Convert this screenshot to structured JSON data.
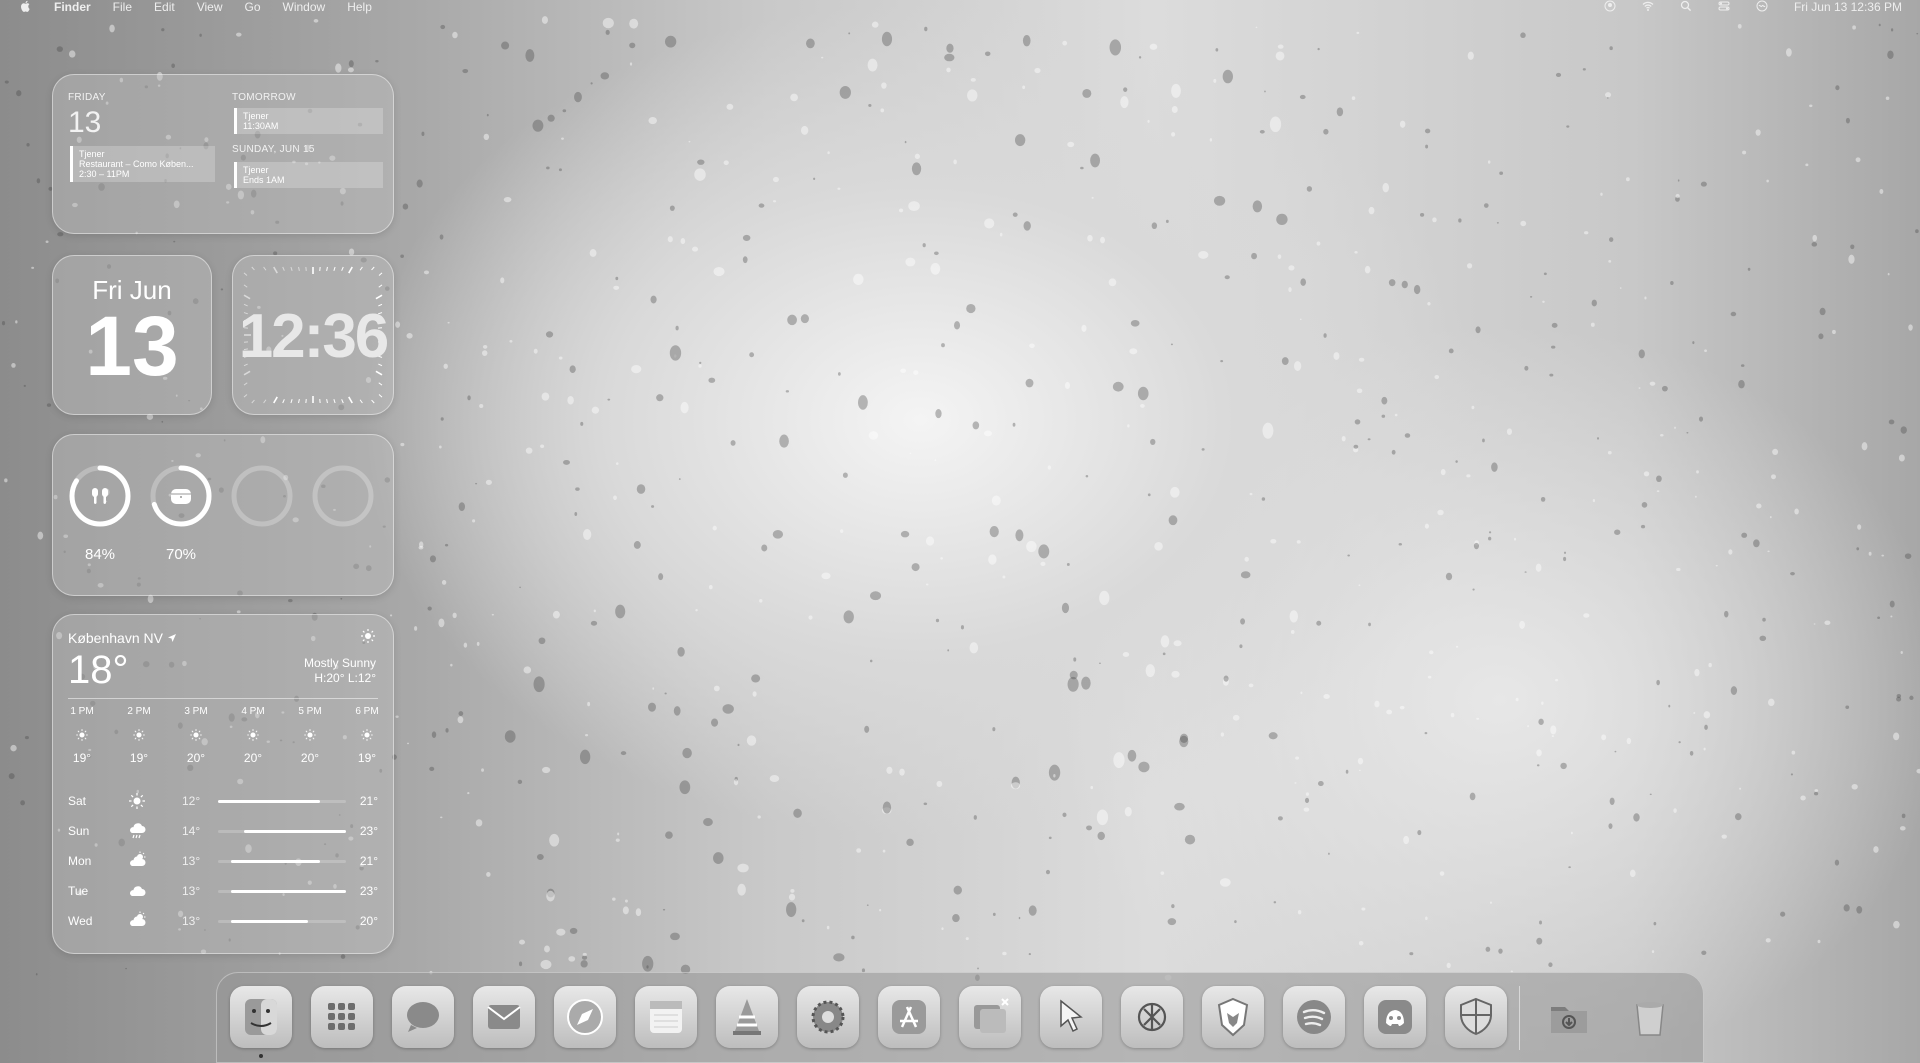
{
  "menubar": {
    "apple": "",
    "app_name": "Finder",
    "menus": [
      "File",
      "Edit",
      "View",
      "Go",
      "Window",
      "Help"
    ],
    "status_icons": [
      "user-icon",
      "wifi-icon",
      "search-icon",
      "control-center-icon",
      "siri-icon"
    ],
    "clock": "Fri Jun 13  12:36 PM"
  },
  "calendar_widget": {
    "today_label": "FRIDAY",
    "today_num": "13",
    "today_event": {
      "title": "Tjener",
      "location": "Restaurant – Como Køben...",
      "time": "2:30 – 11PM"
    },
    "tomorrow_label": "TOMORROW",
    "tomorrow_event": {
      "title": "Tjener",
      "time": "11:30AM"
    },
    "sunday_label": "SUNDAY, JUN 15",
    "sunday_event": {
      "title": "Tjener",
      "time": "Ends 1AM"
    }
  },
  "date_widget": {
    "weekday_month": "Fri Jun",
    "day": "13"
  },
  "clock_widget": {
    "time": "12:36"
  },
  "battery_widget": {
    "devices": [
      {
        "icon": "airpods-icon",
        "level": 0.84,
        "label": "84%"
      },
      {
        "icon": "airpods-case-icon",
        "level": 0.7,
        "label": "70%"
      },
      {
        "icon": "empty-slot",
        "level": 0,
        "label": ""
      },
      {
        "icon": "empty-slot",
        "level": 0,
        "label": ""
      }
    ]
  },
  "weather_widget": {
    "location": "København NV",
    "temperature": "18°",
    "condition": "Mostly Sunny",
    "high_low": "H:20° L:12°",
    "hourly": [
      {
        "time": "1 PM",
        "icon": "sun-icon",
        "temp": "19°"
      },
      {
        "time": "2 PM",
        "icon": "sun-icon",
        "temp": "19°"
      },
      {
        "time": "3 PM",
        "icon": "sun-icon",
        "temp": "20°"
      },
      {
        "time": "4 PM",
        "icon": "sun-icon",
        "temp": "20°"
      },
      {
        "time": "5 PM",
        "icon": "sun-icon",
        "temp": "20°"
      },
      {
        "time": "6 PM",
        "icon": "sun-icon",
        "temp": "19°"
      }
    ],
    "daily": [
      {
        "day": "Sat",
        "icon": "sun-icon",
        "low": "12°",
        "high": "21°",
        "bar_start": 0.0,
        "bar_end": 0.8
      },
      {
        "day": "Sun",
        "icon": "rain-icon",
        "low": "14°",
        "high": "23°",
        "bar_start": 0.2,
        "bar_end": 1.0
      },
      {
        "day": "Mon",
        "icon": "partly-cloudy-icon",
        "low": "13°",
        "high": "21°",
        "bar_start": 0.1,
        "bar_end": 0.8
      },
      {
        "day": "Tue",
        "icon": "cloud-icon",
        "low": "13°",
        "high": "23°",
        "bar_start": 0.1,
        "bar_end": 1.0
      },
      {
        "day": "Wed",
        "icon": "partly-cloudy-icon",
        "low": "13°",
        "high": "20°",
        "bar_start": 0.1,
        "bar_end": 0.7
      }
    ]
  },
  "dock": {
    "apps": [
      {
        "name": "finder-icon",
        "running": true
      },
      {
        "name": "launchpad-icon",
        "running": false
      },
      {
        "name": "messages-icon",
        "running": false
      },
      {
        "name": "mail-icon",
        "running": false
      },
      {
        "name": "safari-icon",
        "running": false
      },
      {
        "name": "notes-icon",
        "running": false
      },
      {
        "name": "vlc-icon",
        "running": false
      },
      {
        "name": "system-settings-icon",
        "running": false
      },
      {
        "name": "app-store-icon",
        "running": false
      },
      {
        "name": "screenshot-icon",
        "running": false
      },
      {
        "name": "cursor-icon",
        "running": false
      },
      {
        "name": "chatgpt-icon",
        "running": false
      },
      {
        "name": "brave-icon",
        "running": false
      },
      {
        "name": "spotify-icon",
        "running": false
      },
      {
        "name": "discord-icon",
        "running": false
      },
      {
        "name": "security-shield-icon",
        "running": false
      }
    ],
    "right": [
      {
        "name": "downloads-folder-icon"
      },
      {
        "name": "trash-icon"
      }
    ]
  }
}
